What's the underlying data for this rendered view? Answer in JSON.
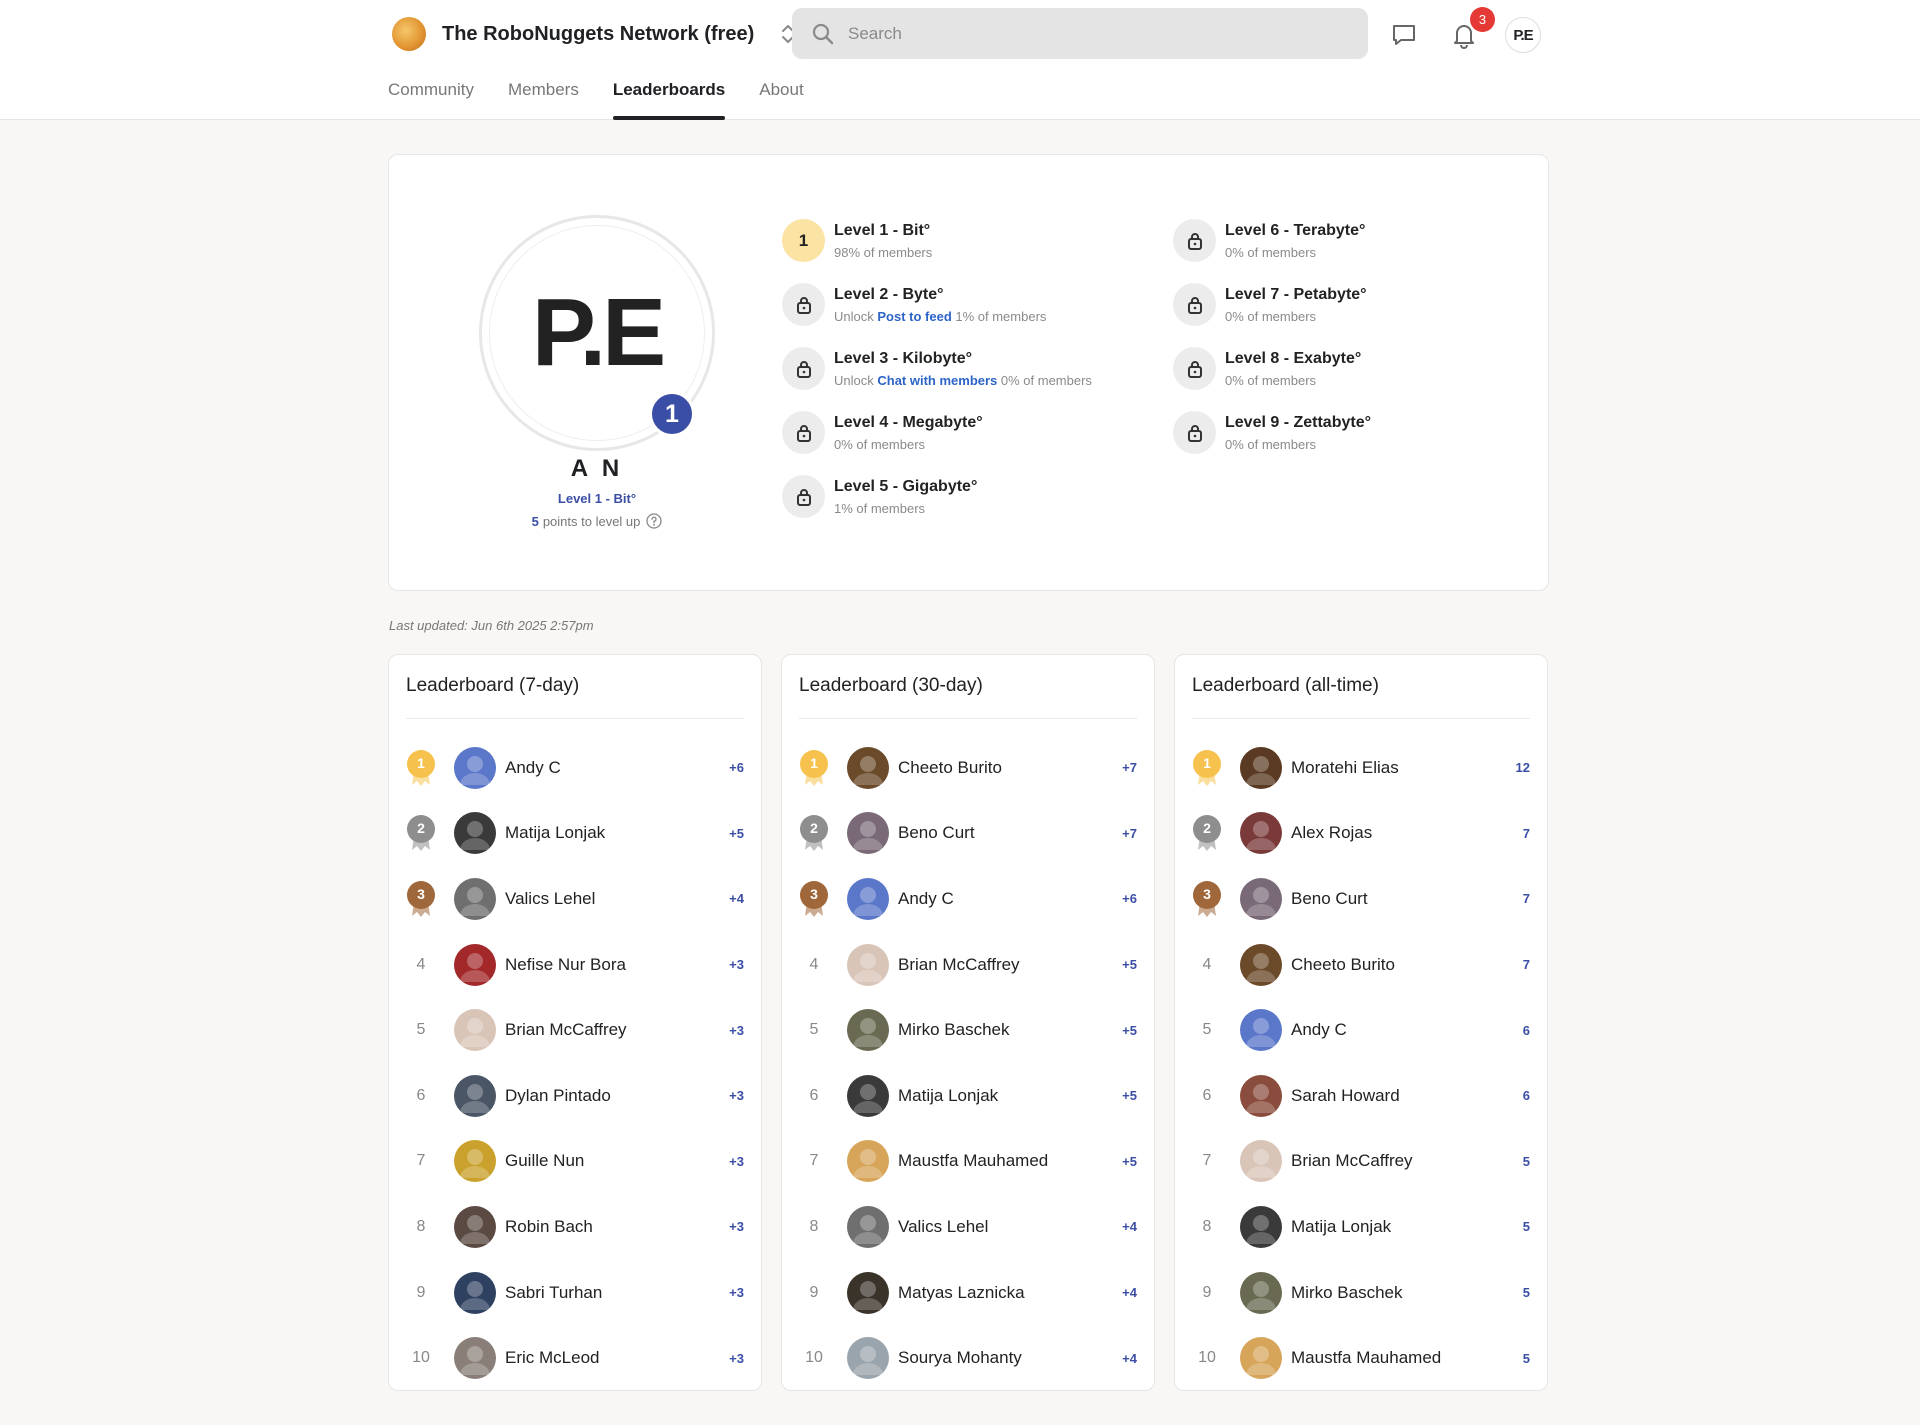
{
  "header": {
    "community_name": "The RoboNuggets Network (free)",
    "search_placeholder": "Search",
    "notification_count": "3",
    "user_initials": "P.E"
  },
  "tabs": [
    {
      "label": "Community",
      "active": false
    },
    {
      "label": "Members",
      "active": false
    },
    {
      "label": "Leaderboards",
      "active": true
    },
    {
      "label": "About",
      "active": false
    }
  ],
  "profile": {
    "avatar_text": "P.E",
    "level_number": "1",
    "name": "A N",
    "level_label": "Level 1 - Bit°",
    "points_to_level": "5",
    "points_suffix": "points to level up"
  },
  "levels": [
    {
      "badge": "1",
      "name": "Level 1 - Bit°",
      "unlock_prefix": "",
      "unlock_link": "",
      "sub": "98% of members",
      "current": true
    },
    {
      "badge": "lock-icon",
      "name": "Level 2 - Byte°",
      "unlock_prefix": "Unlock ",
      "unlock_link": "Post to feed",
      "sub": " 1% of members",
      "current": false
    },
    {
      "badge": "lock-icon",
      "name": "Level 3 - Kilobyte°",
      "unlock_prefix": "Unlock ",
      "unlock_link": "Chat with members",
      "sub": " 0% of members",
      "current": false
    },
    {
      "badge": "lock-icon",
      "name": "Level 4 - Megabyte°",
      "unlock_prefix": "",
      "unlock_link": "",
      "sub": "0% of members",
      "current": false
    },
    {
      "badge": "lock-icon",
      "name": "Level 5 - Gigabyte°",
      "unlock_prefix": "",
      "unlock_link": "",
      "sub": "1% of members",
      "current": false
    },
    {
      "badge": "lock-icon",
      "name": "Level 6 - Terabyte°",
      "unlock_prefix": "",
      "unlock_link": "",
      "sub": "0% of members",
      "current": false
    },
    {
      "badge": "lock-icon",
      "name": "Level 7 - Petabyte°",
      "unlock_prefix": "",
      "unlock_link": "",
      "sub": "0% of members",
      "current": false
    },
    {
      "badge": "lock-icon",
      "name": "Level 8 - Exabyte°",
      "unlock_prefix": "",
      "unlock_link": "",
      "sub": "0% of members",
      "current": false
    },
    {
      "badge": "lock-icon",
      "name": "Level 9 - Zettabyte°",
      "unlock_prefix": "",
      "unlock_link": "",
      "sub": "0% of members",
      "current": false
    }
  ],
  "last_updated": "Last updated: Jun 6th 2025 2:57pm",
  "colors": {
    "accent": "#3b4ea5",
    "gold": "#f6c24d",
    "silver": "#8e8e8e",
    "bronze": "#a0673a",
    "link": "#2d64c8",
    "notification": "#e53935"
  },
  "leaderboards": [
    {
      "title": "Leaderboard (7-day)",
      "rows": [
        {
          "rank": "1",
          "name": "Andy C",
          "points": "+6",
          "avatar_color": "#5b77c9"
        },
        {
          "rank": "2",
          "name": "Matija Lonjak",
          "points": "+5",
          "avatar_color": "#3a3a3a"
        },
        {
          "rank": "3",
          "name": "Valics Lehel",
          "points": "+4",
          "avatar_color": "#6f6f6f"
        },
        {
          "rank": "4",
          "name": "Nefise Nur Bora",
          "points": "+3",
          "avatar_color": "#a3282a"
        },
        {
          "rank": "5",
          "name": "Brian McCaffrey",
          "points": "+3",
          "avatar_color": "#d9c4b8"
        },
        {
          "rank": "6",
          "name": "Dylan Pintado",
          "points": "+3",
          "avatar_color": "#4a5566"
        },
        {
          "rank": "7",
          "name": "Guille Nun",
          "points": "+3",
          "avatar_color": "#c9a12c"
        },
        {
          "rank": "8",
          "name": "Robin Bach",
          "points": "+3",
          "avatar_color": "#5a4a42"
        },
        {
          "rank": "9",
          "name": "Sabri Turhan",
          "points": "+3",
          "avatar_color": "#2f4160"
        },
        {
          "rank": "10",
          "name": "Eric McLeod",
          "points": "+3",
          "avatar_color": "#8a7f78"
        }
      ]
    },
    {
      "title": "Leaderboard (30-day)",
      "rows": [
        {
          "rank": "1",
          "name": "Cheeto Burito",
          "points": "+7",
          "avatar_color": "#6b4a2a"
        },
        {
          "rank": "2",
          "name": "Beno Curt",
          "points": "+7",
          "avatar_color": "#7a6a78"
        },
        {
          "rank": "3",
          "name": "Andy C",
          "points": "+6",
          "avatar_color": "#5b77c9"
        },
        {
          "rank": "4",
          "name": "Brian McCaffrey",
          "points": "+5",
          "avatar_color": "#d9c4b8"
        },
        {
          "rank": "5",
          "name": "Mirko Baschek",
          "points": "+5",
          "avatar_color": "#6a6a52"
        },
        {
          "rank": "6",
          "name": "Matija Lonjak",
          "points": "+5",
          "avatar_color": "#3a3a3a"
        },
        {
          "rank": "7",
          "name": "Maustfa Mauhamed",
          "points": "+5",
          "avatar_color": "#d6a55a"
        },
        {
          "rank": "8",
          "name": "Valics Lehel",
          "points": "+4",
          "avatar_color": "#6f6f6f"
        },
        {
          "rank": "9",
          "name": "Matyas Laznicka",
          "points": "+4",
          "avatar_color": "#3a3329"
        },
        {
          "rank": "10",
          "name": "Sourya Mohanty",
          "points": "+4",
          "avatar_color": "#9aa4ac"
        }
      ]
    },
    {
      "title": "Leaderboard (all-time)",
      "rows": [
        {
          "rank": "1",
          "name": "Moratehi Elias",
          "points": "12",
          "avatar_color": "#5a3a22"
        },
        {
          "rank": "2",
          "name": "Alex Rojas",
          "points": "7",
          "avatar_color": "#7a3a3a"
        },
        {
          "rank": "3",
          "name": "Beno Curt",
          "points": "7",
          "avatar_color": "#7a6a78"
        },
        {
          "rank": "4",
          "name": "Cheeto Burito",
          "points": "7",
          "avatar_color": "#6b4a2a"
        },
        {
          "rank": "5",
          "name": "Andy C",
          "points": "6",
          "avatar_color": "#5b77c9"
        },
        {
          "rank": "6",
          "name": "Sarah Howard",
          "points": "6",
          "avatar_color": "#8a4c3c"
        },
        {
          "rank": "7",
          "name": "Brian McCaffrey",
          "points": "5",
          "avatar_color": "#d9c4b8"
        },
        {
          "rank": "8",
          "name": "Matija Lonjak",
          "points": "5",
          "avatar_color": "#3a3a3a"
        },
        {
          "rank": "9",
          "name": "Mirko Baschek",
          "points": "5",
          "avatar_color": "#6a6a52"
        },
        {
          "rank": "10",
          "name": "Maustfa Mauhamed",
          "points": "5",
          "avatar_color": "#d6a55a"
        }
      ]
    }
  ]
}
